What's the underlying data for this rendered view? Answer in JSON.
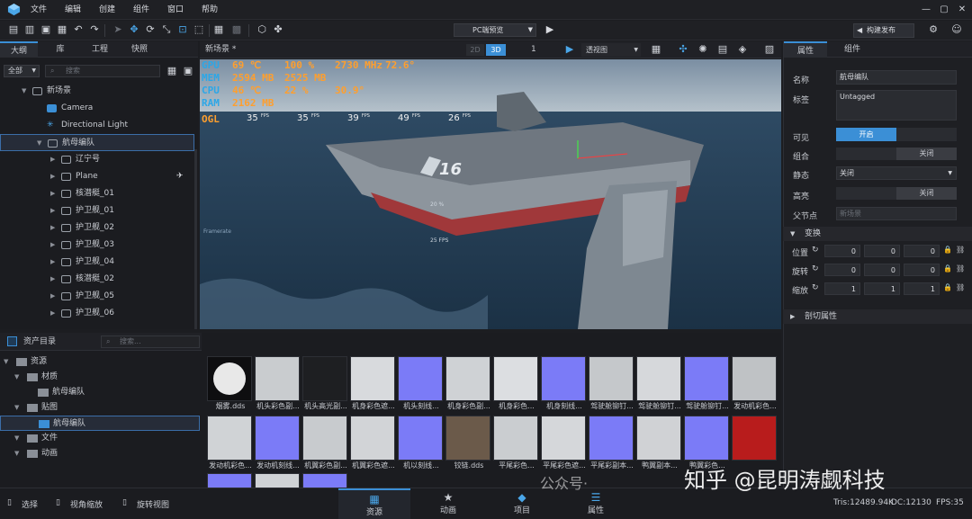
{
  "menubar": {
    "items": [
      "文件",
      "编辑",
      "创建",
      "组件",
      "窗口",
      "帮助"
    ]
  },
  "toolbar": {
    "preview_label": "PC端预览",
    "publish_label": "构建发布"
  },
  "outline": {
    "tabs": [
      "大纲",
      "库",
      "工程",
      "快照"
    ],
    "filter": "全部",
    "search_placeholder": "搜索",
    "tree": [
      {
        "label": "新场景",
        "indent": 0,
        "expanded": true
      },
      {
        "label": "Camera",
        "indent": 1
      },
      {
        "label": "Directional Light",
        "indent": 1
      },
      {
        "label": "航母编队",
        "indent": 1,
        "expanded": true,
        "selected": true
      },
      {
        "label": "辽宁号",
        "indent": 2
      },
      {
        "label": "Plane",
        "indent": 2
      },
      {
        "label": "核潜艇_01",
        "indent": 2
      },
      {
        "label": "护卫舰_01",
        "indent": 2
      },
      {
        "label": "护卫舰_02",
        "indent": 2
      },
      {
        "label": "护卫舰_03",
        "indent": 2
      },
      {
        "label": "护卫舰_04",
        "indent": 2
      },
      {
        "label": "核潜艇_02",
        "indent": 2
      },
      {
        "label": "护卫舰_05",
        "indent": 2
      },
      {
        "label": "护卫舰_06",
        "indent": 2
      }
    ]
  },
  "scene": {
    "tab_label": "新场景 *",
    "mode_2d": "2D",
    "mode_3d": "3D",
    "count": "1",
    "view_label": "透视图"
  },
  "overlay": {
    "rows": [
      {
        "label": "GPU",
        "a": "69",
        "au": "℃",
        "b": "100",
        "bu": "%",
        "c": "2730",
        "cu": "MHz",
        "d": "72.6°"
      },
      {
        "label": "MEM",
        "a": "2594",
        "au": "MB",
        "b": "2525",
        "bu": "MB",
        "c": "",
        "cu": "",
        "d": ""
      },
      {
        "label": "CPU",
        "a": "46",
        "au": "℃",
        "b": "22",
        "bu": "%",
        "c": "30.9°",
        "cu": "",
        "d": ""
      },
      {
        "label": "RAM",
        "a": "2162",
        "au": "MB",
        "b": "",
        "bu": "",
        "c": "",
        "cu": "",
        "d": ""
      }
    ],
    "ogl": "OGL",
    "fps": [
      "35",
      "35",
      "39",
      "49",
      "26"
    ],
    "fps_unit": "FPS",
    "hull_number": "16",
    "pct": "20 %",
    "fps_small": "25 FPS",
    "framerate": "Framerate"
  },
  "assets": {
    "title": "资产目录",
    "search_placeholder": "搜索...",
    "tree": [
      {
        "label": "资源",
        "indent": 0
      },
      {
        "label": "材质",
        "indent": 1
      },
      {
        "label": "航母编队",
        "indent": 2
      },
      {
        "label": "贴图",
        "indent": 1
      },
      {
        "label": "航母编队",
        "indent": 2,
        "selected": true
      },
      {
        "label": "文件",
        "indent": 1
      },
      {
        "label": "动画",
        "indent": 1
      }
    ],
    "row1": [
      "烟雾.dds",
      "机头彩色副...",
      "机头高光副...",
      "机身彩色遮...",
      "机头刻线...",
      "机身彩色副...",
      "机身彩色...",
      "机身刻线...",
      "驾驶舱铆钉...",
      "驾驶舱铆钉...",
      "驾驶舱铆钉...",
      "发动机彩色..."
    ],
    "row2": [
      "发动机彩色...",
      "发动机刻线...",
      "机翼彩色副...",
      "机翼彩色遮...",
      "机以刻线...",
      "铰链.dds",
      "平尾彩色...",
      "平尾彩色遮...",
      "平尾彩副本...",
      "鸭翼副本...",
      "鸭翼彩色...",
      ""
    ]
  },
  "props": {
    "tabs": [
      "属性",
      "组件"
    ],
    "name_label": "名称",
    "name_value": "航母编队",
    "tag_label": "标签",
    "tag_value": "Untagged",
    "visible_label": "可见",
    "visible_value": "开启",
    "combine_label": "组合",
    "combine_value": "关闭",
    "static_label": "静态",
    "static_value": "关闭",
    "highlight_label": "高亮",
    "highlight_value": "关闭",
    "parent_label": "父节点",
    "parent_value": "新场景",
    "transform_title": "变换",
    "pos_label": "位置",
    "pos": [
      "0",
      "0",
      "0"
    ],
    "rot_label": "旋转",
    "rot": [
      "0",
      "0",
      "0"
    ],
    "scale_label": "缩放",
    "scale": [
      "1",
      "1",
      "1"
    ],
    "clip_title": "剖切属性"
  },
  "statusbar": {
    "select": "选择",
    "zoom": "视角缩放",
    "rotate": "旋转视图",
    "tabs": [
      "资源",
      "动画",
      "项目",
      "属性"
    ],
    "tris": "Tris:12489.94K",
    "dc": "DC:12130",
    "fps": "FPS:35"
  },
  "watermark": {
    "text1": "公众号·",
    "text2": "知乎 @昆明涛觑科技"
  },
  "colors": {
    "accent": "#3b8fd6",
    "stat_orange": "#ff9f2e",
    "stat_blue": "#2ba7e8",
    "normal_map": "#7b7bf7",
    "red_tex": "#b81c1c"
  }
}
